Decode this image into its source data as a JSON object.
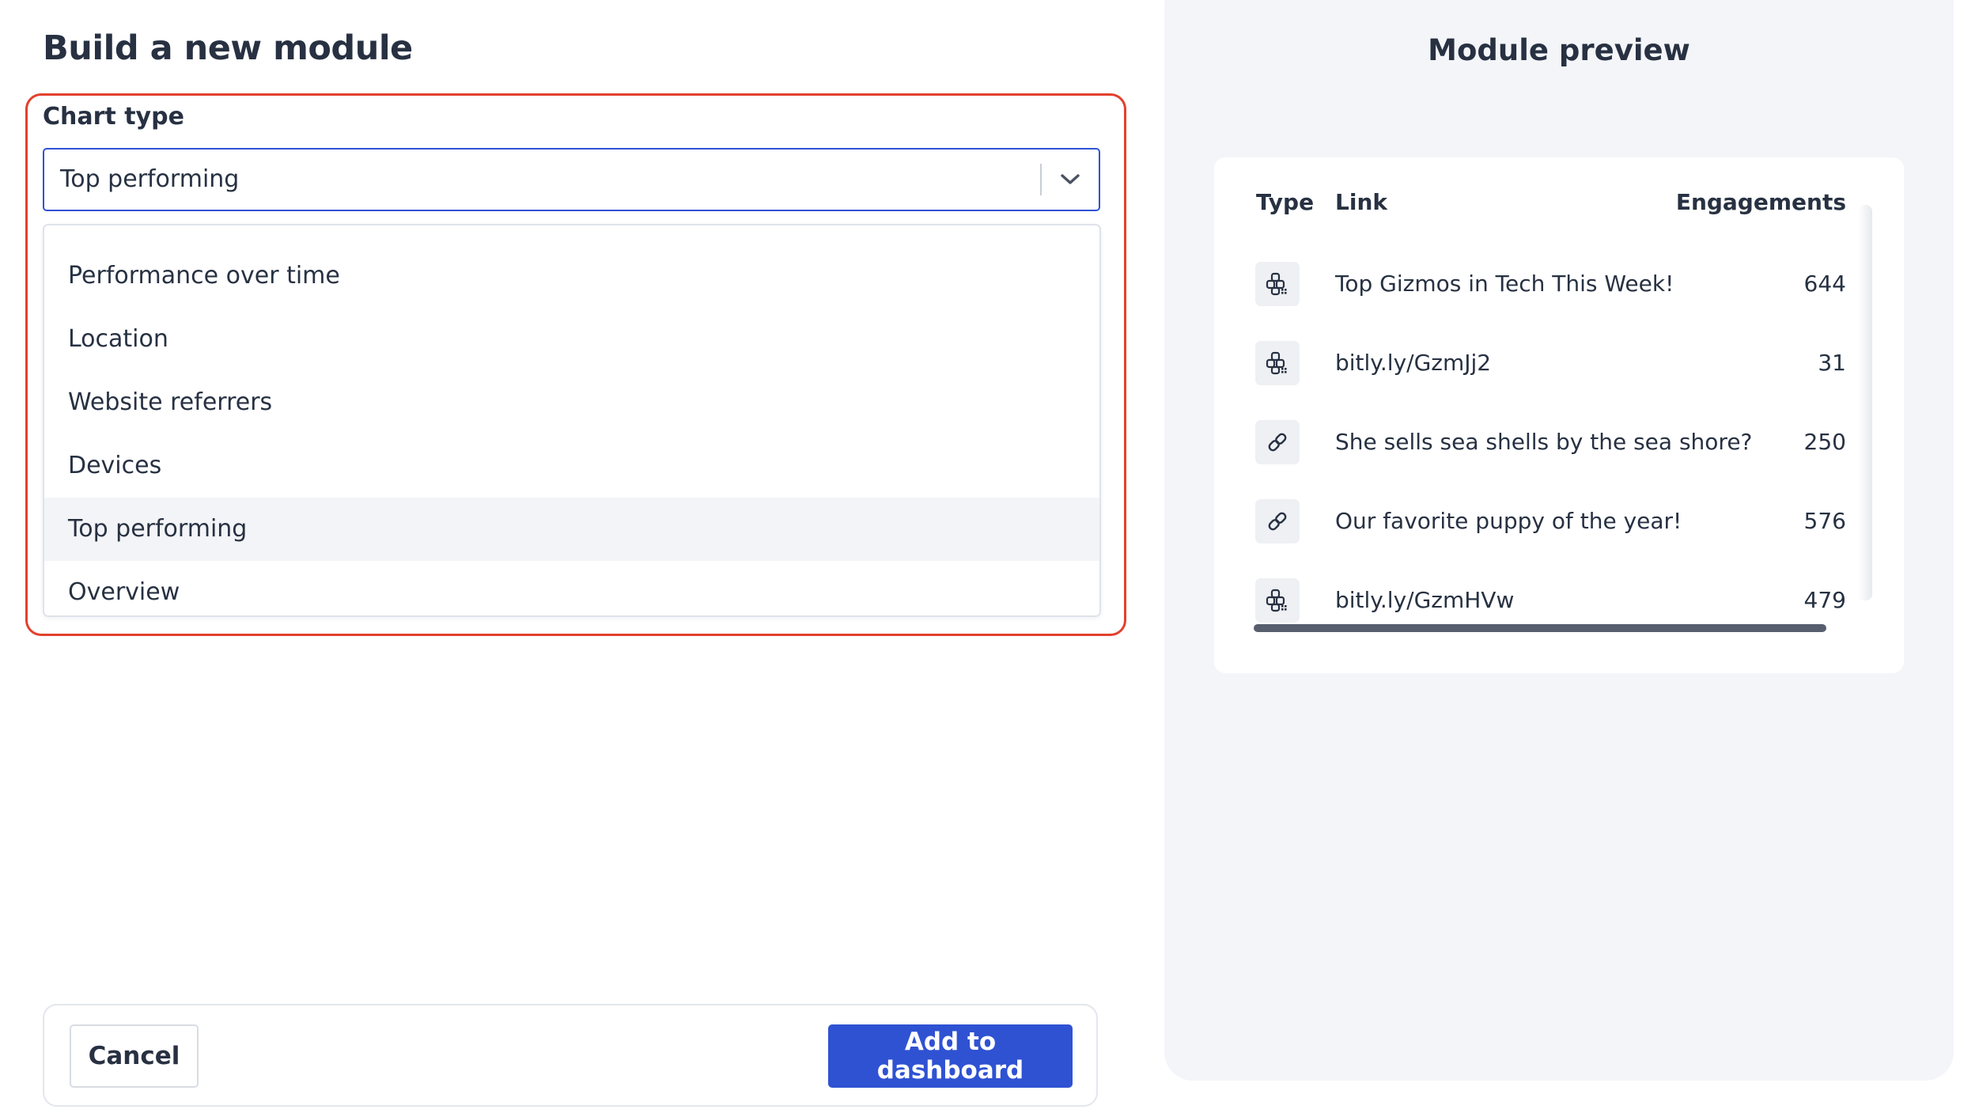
{
  "page": {
    "title": "Build a new module"
  },
  "chart_type": {
    "label": "Chart type",
    "selected": "Top performing",
    "options": [
      "Performance over time",
      "Location",
      "Website referrers",
      "Devices",
      "Top performing",
      "Overview"
    ]
  },
  "footer": {
    "cancel_label": "Cancel",
    "add_label": "Add to dashboard"
  },
  "preview": {
    "title": "Module preview",
    "columns": {
      "type": "Type",
      "link": "Link",
      "engagements": "Engagements"
    },
    "rows": [
      {
        "type_icon": "qr-code-icon",
        "link": "Top Gizmos in Tech This Week!",
        "engagements": "644"
      },
      {
        "type_icon": "qr-code-icon",
        "link": "bitly.ly/GzmJj2",
        "engagements": "31"
      },
      {
        "type_icon": "link-icon",
        "link": "She sells sea shells by the sea shore?",
        "engagements": "250"
      },
      {
        "type_icon": "link-icon",
        "link": "Our favorite puppy of the year!",
        "engagements": "576"
      },
      {
        "type_icon": "qr-code-icon",
        "link": "bitly.ly/GzmHVw",
        "engagements": "479"
      }
    ]
  },
  "colors": {
    "accent": "#2f52d3",
    "focus_outline": "#e2402d",
    "text": "#273142",
    "preview_background": "#f4f5f9",
    "selected_option": "#f3f4f7"
  }
}
